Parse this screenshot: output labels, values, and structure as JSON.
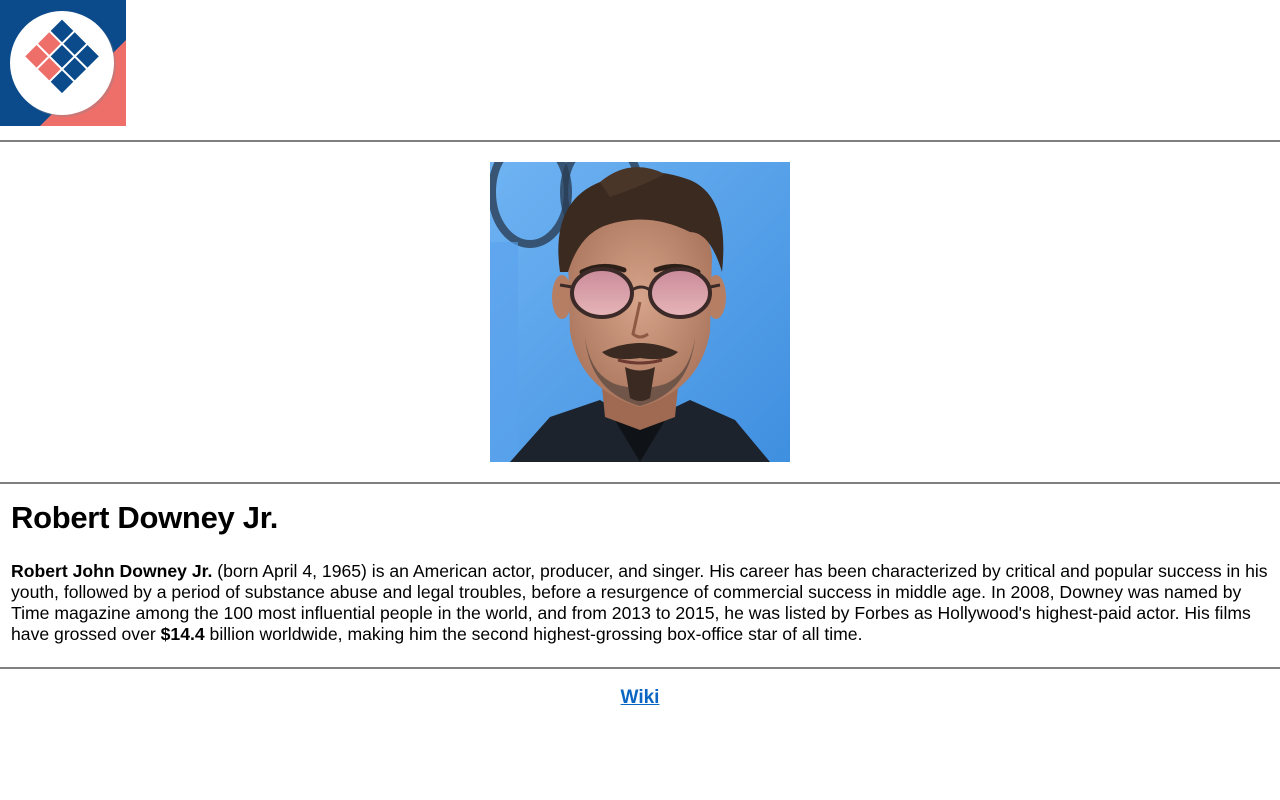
{
  "header": {
    "logo_icon": "diamond-grid-logo-icon",
    "colors": {
      "navy": "#0b4a8b",
      "coral": "#ee6e6a"
    }
  },
  "profile": {
    "photo_icon": "portrait-photo",
    "name": "Robert Downey Jr.",
    "bio": {
      "full_name": "Robert John Downey Jr.",
      "text_1": " (born April 4, 1965) is an American actor, producer, and singer. His career has been characterized by critical and popular success in his youth, followed by a period of substance abuse and legal troubles, before a resurgence of commercial success in middle age. In 2008, Downey was named by Time magazine among the 100 most influential people in the world, and from 2013 to 2015, he was listed by Forbes as Hollywood's highest-paid actor. His films have grossed over ",
      "gross": "$14.4",
      "text_2": " billion worldwide, making him the second highest-grossing box-office star of all time."
    }
  },
  "footer": {
    "link_label": "Wiki",
    "link_color": "#0a66c2"
  }
}
